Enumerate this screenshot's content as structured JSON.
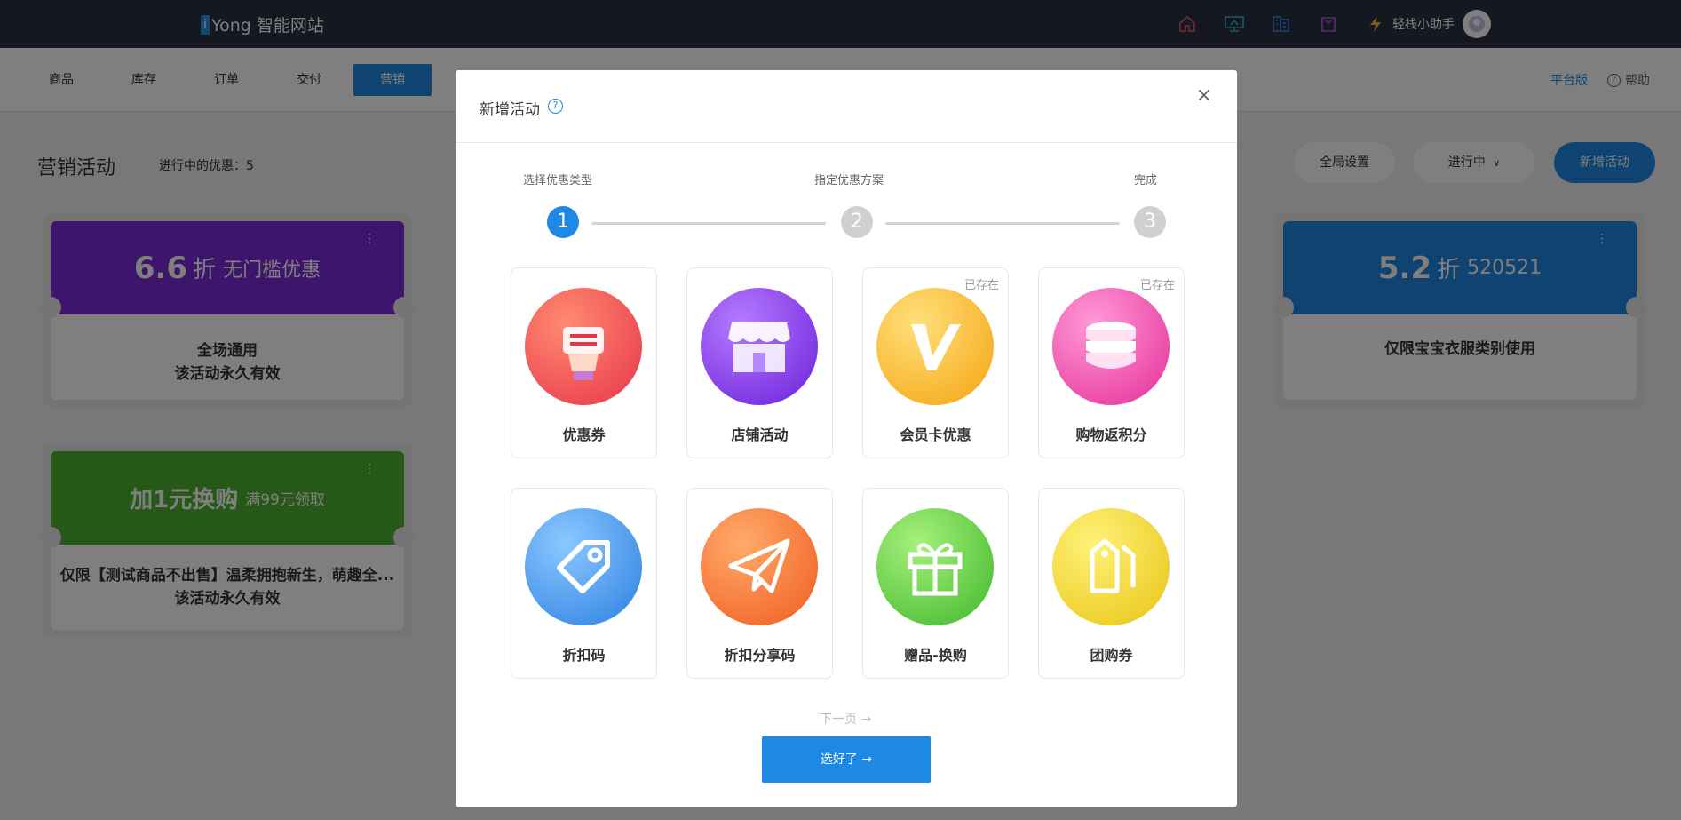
{
  "app": {
    "logo_mark": "i",
    "logo_text": "Yong 智能网站",
    "assistant": "轻栈小助手"
  },
  "nav": {
    "tabs": [
      "商品",
      "库存",
      "订单",
      "交付",
      "营销"
    ],
    "active_tab": "营销",
    "platform": "平台版",
    "help": "帮助"
  },
  "page": {
    "title": "营销活动",
    "count_text": "进行中的优惠：5",
    "btn_global": "全局设置",
    "btn_status": "进行中",
    "btn_new": "新增活动"
  },
  "cards": [
    {
      "value": "6.6",
      "unit": "折",
      "sub": "无门槛优惠",
      "line1": "全场通用",
      "line2": "该活动永久有效",
      "color": "#7b2bd9",
      "menu": "⋮"
    },
    {
      "value": "加1元换购",
      "unit": "",
      "sub": "满99元领取",
      "line1": "仅限【测试商品不出售】温柔拥抱新生，萌趣全...",
      "line2": "该活动永久有效",
      "color": "#4cb32f",
      "menu": "⋮"
    },
    {
      "value": "5.2",
      "unit": "折",
      "sub": "520521",
      "line1": "仅限宝宝衣服类别使用",
      "line2": "",
      "color": "#1e88e5",
      "menu": "⋮"
    }
  ],
  "modal": {
    "title": "新增活动",
    "help_icon": "?",
    "close": "×",
    "steps": [
      {
        "label": "选择优惠类型",
        "num": "1"
      },
      {
        "label": "指定优惠方案",
        "num": "2"
      },
      {
        "label": "完成",
        "num": "3"
      }
    ],
    "types": [
      {
        "label": "优惠券",
        "tag": "",
        "icon": "coupon-hand-icon"
      },
      {
        "label": "店铺活动",
        "tag": "",
        "icon": "store-icon"
      },
      {
        "label": "会员卡优惠",
        "tag": "已存在",
        "icon": "vip-card-icon"
      },
      {
        "label": "购物返积分",
        "tag": "已存在",
        "icon": "coin-stack-icon"
      },
      {
        "label": "折扣码",
        "tag": "",
        "icon": "tag-icon"
      },
      {
        "label": "折扣分享码",
        "tag": "",
        "icon": "paper-plane-icon"
      },
      {
        "label": "赠品-换购",
        "tag": "",
        "icon": "gift-icon"
      },
      {
        "label": "团购券",
        "tag": "",
        "icon": "group-tags-icon"
      }
    ],
    "next_page": "下一页 →",
    "done_btn": "选好了 →"
  }
}
